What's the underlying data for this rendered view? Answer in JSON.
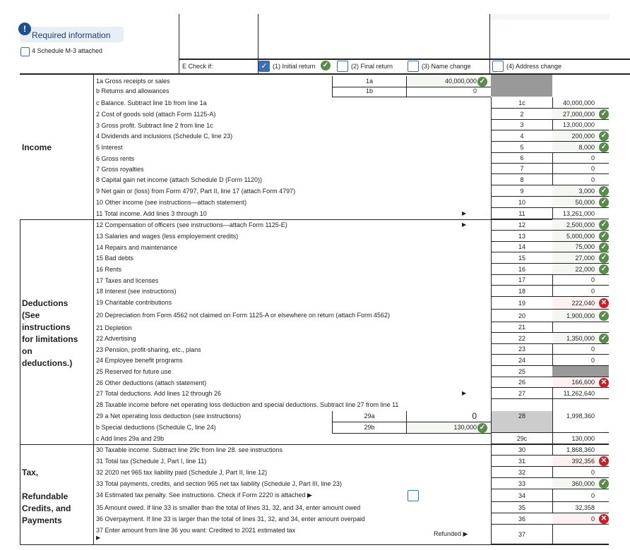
{
  "banner": {
    "label": "Required information",
    "icon": "exclamation-icon"
  },
  "schedule_m3": {
    "label": "4 Schedule M-3 attached",
    "checked": false
  },
  "check_if": {
    "label": "E  Check if:",
    "options": [
      {
        "label": "(1) Initial return",
        "checked": true,
        "status": "ok"
      },
      {
        "label": "(2) Final return",
        "checked": false
      },
      {
        "label": "(3) Name change",
        "checked": false
      },
      {
        "label": "(4) Address change",
        "checked": false
      }
    ]
  },
  "sections": {
    "income": "Income",
    "deductions": [
      "Deductions",
      "(See",
      "instructions",
      "for limitations",
      "on",
      "deductions.)"
    ],
    "tax": [
      "Tax,",
      "",
      "Refundable",
      "Credits, and",
      "Payments"
    ]
  },
  "sub_lines": [
    {
      "desc": "1a Gross receipts or sales",
      "line": "1a",
      "value": "40,000,000",
      "status": "ok"
    },
    {
      "desc": "b  Returns and allowances",
      "line": "1b",
      "value": "0",
      "status": ""
    },
    {
      "desc": "29 a Net operating loss deduction (see instructions)",
      "line": "29a",
      "value": "0",
      "status": ""
    },
    {
      "desc": "b     Special deductions (Schedule C, line 24)",
      "line": "29b",
      "value": "130,000",
      "status": "ok"
    }
  ],
  "lines": [
    {
      "desc": "c  Balance.  Subtract line 1b from line 1a",
      "line": "1c",
      "value": "40,000,000",
      "status": ""
    },
    {
      "desc": "2  Cost of goods sold (attach Form 1125-A)",
      "line": "2",
      "value": "27,000,000",
      "status": "ok"
    },
    {
      "desc": "3  Gross profit.  Subtract line 2 from line 1c",
      "line": "3",
      "value": "13,000,000",
      "status": ""
    },
    {
      "desc": "4  Dividends and inclusions (Schedule C, line 23)",
      "line": "4",
      "value": "200,000",
      "status": "ok"
    },
    {
      "desc": "5  Interest",
      "line": "5",
      "value": "8,000",
      "status": "ok"
    },
    {
      "desc": "6  Gross rents",
      "line": "6",
      "value": "0",
      "status": ""
    },
    {
      "desc": "7  Gross royalties",
      "line": "7",
      "value": "0",
      "status": ""
    },
    {
      "desc": "8  Capital gain net income (attach Schedule D (Form 1120))",
      "line": "8",
      "value": "0",
      "status": ""
    },
    {
      "desc": "9  Net gain or (loss) from Form 4797, Part II, line 17 (attach Form 4797)",
      "line": "9",
      "value": "3,000",
      "status": "ok"
    },
    {
      "desc": "10 Other income (see instructions—attach statement)",
      "line": "10",
      "value": "50,000",
      "status": "ok"
    },
    {
      "desc": "11 Total income.  Add lines 3 through 10",
      "line": "11",
      "value": "13,261,000",
      "status": "",
      "arrow": "▶"
    },
    {
      "desc": "12 Compensation of officers (see instructions—attach Form 1125-E)",
      "line": "12",
      "value": "2,500,000",
      "status": "ok",
      "arrow": "▶"
    },
    {
      "desc": "13 Salaries and wages (less employement credits)",
      "line": "13",
      "value": "5,000,000",
      "status": "ok"
    },
    {
      "desc": "14 Repairs and maintenance",
      "line": "14",
      "value": "75,000",
      "status": "ok"
    },
    {
      "desc": "15 Bad debts",
      "line": "15",
      "value": "27,000",
      "status": "ok"
    },
    {
      "desc": "16 Rents",
      "line": "16",
      "value": "22,000",
      "status": "ok"
    },
    {
      "desc": "17 Taxes and licenses",
      "line": "17",
      "value": "0",
      "status": ""
    },
    {
      "desc": "18 Interest (see instructions)",
      "line": "18",
      "value": "0",
      "status": ""
    },
    {
      "desc": "19 Charitable contributions",
      "line": "19",
      "value": "222,040",
      "status": "err"
    },
    {
      "desc": "20 Depreciation from Form 4562 not claimed on Form 1125-A or elsewhere on return (attach Form 4562)",
      "line": "20",
      "value": "1,900,000",
      "status": "ok"
    },
    {
      "desc": "21 Depletion",
      "line": "21",
      "value": "",
      "status": ""
    },
    {
      "desc": "22 Advertising",
      "line": "22",
      "value": "1,350,000",
      "status": "ok"
    },
    {
      "desc": "23 Pension, profit-sharing, etc., plans",
      "line": "23",
      "value": "0",
      "status": ""
    },
    {
      "desc": "24 Employee benefit programs",
      "line": "24",
      "value": "0",
      "status": ""
    },
    {
      "desc": "25 Reserved for future use",
      "line": "25",
      "value": "",
      "status": "gray"
    },
    {
      "desc": "26 Other deductions (attach statement)",
      "line": "26",
      "value": "166,600",
      "status": "err"
    },
    {
      "desc": "27 Total deductions.  Add lines 12 through 26",
      "line": "27",
      "value": "11,262,640",
      "status": "",
      "arrow": "▶"
    },
    {
      "desc": "28 Taxable income before net operating loss deduction and special deductions.  Subtract line 27 from line 11",
      "line": "28",
      "value": "1,998,360",
      "status": ""
    },
    {
      "desc": "c     Add lines 29a and 29b",
      "line": "29c",
      "value": "130,000",
      "status": ""
    },
    {
      "desc": "30 Taxable income.  Subtract line 29c from line 28. see instructions",
      "line": "30",
      "value": "1,868,360",
      "status": ""
    },
    {
      "desc": "31 Total tax (Schedule J, Part I, line 11)",
      "line": "31",
      "value": "392,356",
      "status": "err"
    },
    {
      "desc": "32 2020 net 965 tax liability paid (Schedule J, Part II, line 12)",
      "line": "32",
      "value": "0",
      "status": ""
    },
    {
      "desc": "33 Total payments, credits, and section 965 net tax liability (Schedule J, Part III, line 23)",
      "line": "33",
      "value": "360,000",
      "status": "ok"
    },
    {
      "desc": "34 Estimated tax penalty. See instructions. Check if Form 2220 is attached ▶",
      "line": "34",
      "value": "0",
      "status": "",
      "checkbox": true
    },
    {
      "desc": "35 Amount owed. If line 33 is smaller than the total of lines 31, 32, and 34, enter amount owed",
      "line": "35",
      "value": "32,358",
      "status": ""
    },
    {
      "desc": "36 Overpayment. If line 33 is larger than the total of lines 31, 32, and 34, enter amount overpaid",
      "line": "36",
      "value": "0",
      "status": "err"
    },
    {
      "desc": "37 Enter amount from line 36 you want: Credited to 2021 estimated tax",
      "line": "37",
      "value": "",
      "status": "",
      "refunded": "Refunded ▶",
      "arrow2": "▶"
    }
  ],
  "colors": {
    "ok": "#5a8a4e",
    "error": "#c0232b",
    "checkbox": "#3a6fb0"
  }
}
